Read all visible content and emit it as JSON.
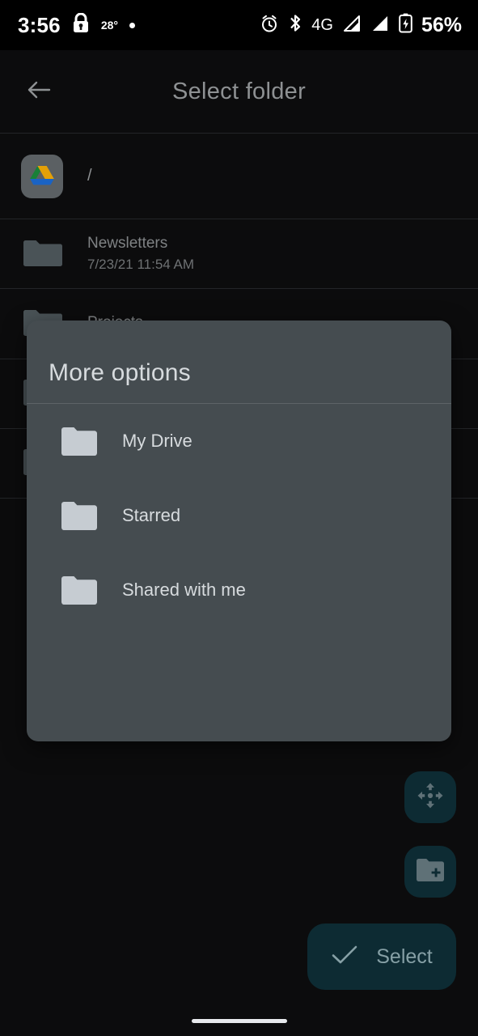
{
  "status_bar": {
    "time": "3:56",
    "lock_icon": "lock-icon",
    "temperature": "28°",
    "dot_icon": "dot-indicator-icon",
    "alarm_icon": "alarm-clock-icon",
    "bluetooth_icon": "bluetooth-icon",
    "network_type": "4G",
    "signal_icon_1": "signal-bars-icon",
    "signal_icon_2": "signal-bars-icon",
    "battery_icon": "battery-charging-icon",
    "battery_level": "56%"
  },
  "app_bar": {
    "back_icon": "back-arrow-icon",
    "title": "Select folder"
  },
  "breadcrumb": {
    "drive_icon": "google-drive-icon",
    "path": "/"
  },
  "file_list": [
    {
      "icon": "folder-icon",
      "name": "Newsletters",
      "modified": "7/23/21 11:54 AM"
    },
    {
      "icon": "folder-icon",
      "name": "Projects",
      "modified": ""
    }
  ],
  "dialog": {
    "title": "More options",
    "options": [
      {
        "icon": "folder-icon",
        "label": "My Drive"
      },
      {
        "icon": "folder-icon",
        "label": "Starred"
      },
      {
        "icon": "folder-icon",
        "label": "Shared with me"
      }
    ]
  },
  "fabs": [
    {
      "name": "move-fab",
      "icon": "move-arrows-icon"
    },
    {
      "name": "new-folder-fab",
      "icon": "folder-plus-icon"
    }
  ],
  "select_button": {
    "icon": "check-icon",
    "label": "Select"
  },
  "navigation": {
    "home_pill": "gesture-home-pill"
  },
  "colors": {
    "background": "#0c0c0d",
    "status_bar": "#000000",
    "dialog": "#454c50",
    "accent_teal": "#0d2b33",
    "text_primary": "#d7dbde",
    "text_muted": "#7f8284",
    "divider": "#232528",
    "drive_green": "#188038",
    "drive_yellow": "#e3a008",
    "drive_blue": "#1a63c4"
  }
}
